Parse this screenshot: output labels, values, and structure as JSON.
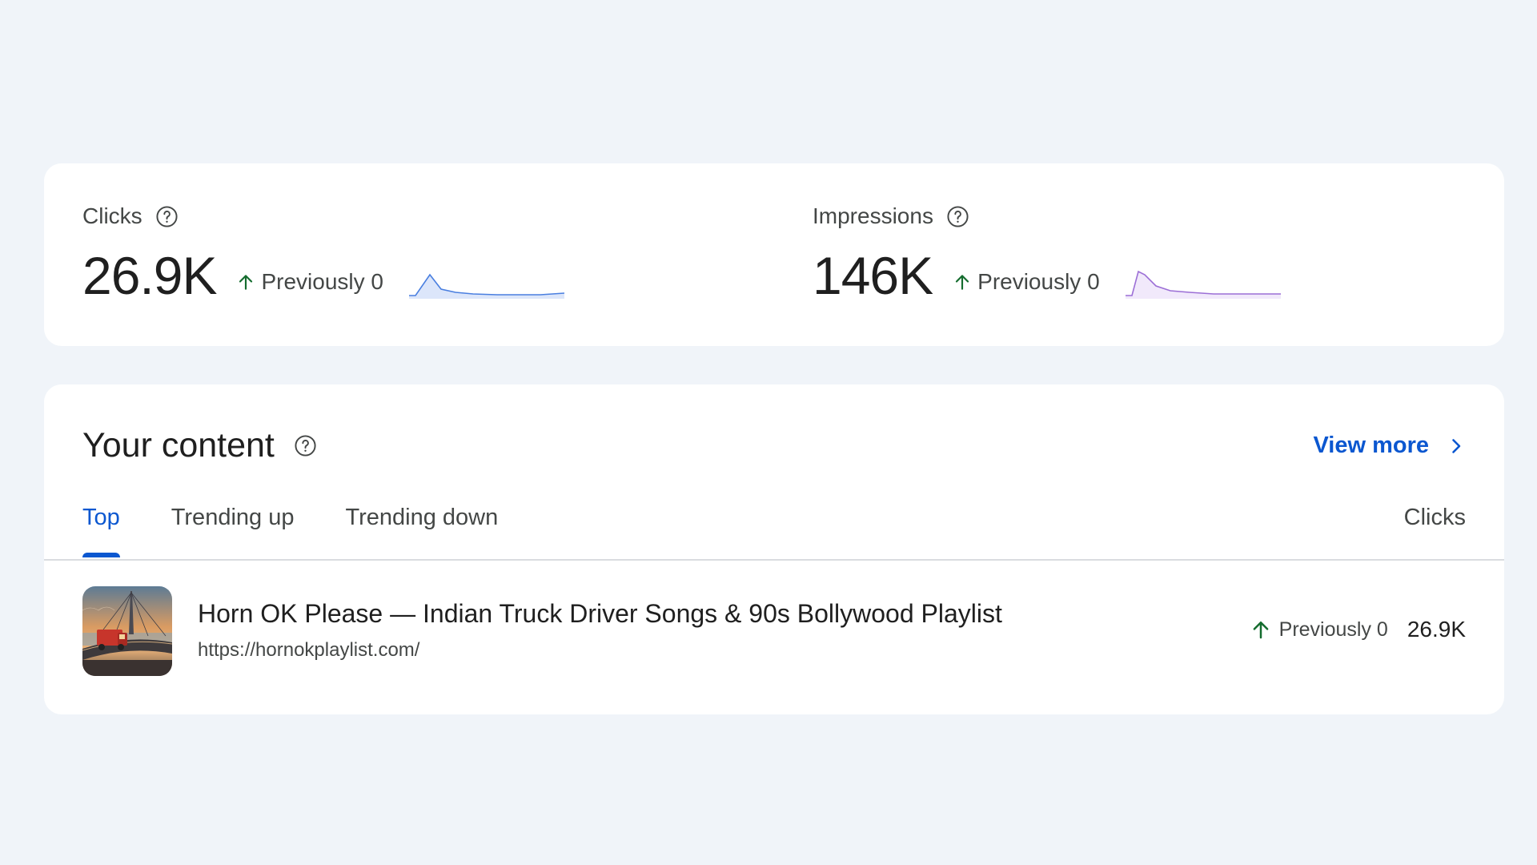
{
  "metrics": {
    "clicks": {
      "label": "Clicks",
      "value": "26.9K",
      "trend": "Previously 0",
      "sparkline_color": "#4a7fe0",
      "sparkline_fill": "#dce6fa"
    },
    "impressions": {
      "label": "Impressions",
      "value": "146K",
      "trend": "Previously 0",
      "sparkline_color": "#9c6fd6",
      "sparkline_fill": "#f1e9fb"
    }
  },
  "content": {
    "title": "Your content",
    "view_more": "View more",
    "tabs": [
      {
        "label": "Top",
        "active": true
      },
      {
        "label": "Trending up",
        "active": false
      },
      {
        "label": "Trending down",
        "active": false
      }
    ],
    "column_header": "Clicks",
    "rows": [
      {
        "title": "Horn OK Please — Indian Truck Driver Songs & 90s Bollywood Playlist",
        "url": "https://hornokplaylist.com/",
        "trend": "Previously 0",
        "value": "26.9K"
      }
    ]
  },
  "colors": {
    "accent": "#0b57d0",
    "trend_up": "#146c2e",
    "background": "#f0f4f9"
  },
  "icons": {
    "help": "help-circle-icon",
    "trend": "arrow-up-icon",
    "view_more": "chevron-right-icon"
  }
}
